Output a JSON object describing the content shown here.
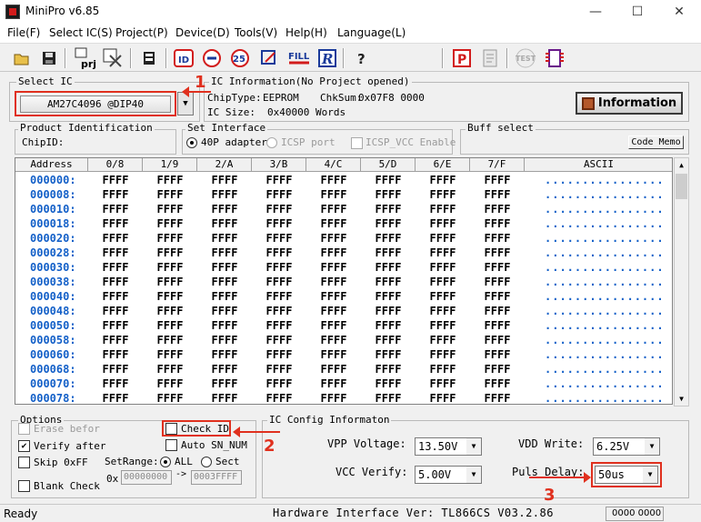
{
  "window": {
    "title": "MiniPro v6.85",
    "min": "—",
    "max": "☐",
    "close": "✕"
  },
  "menu": [
    "File(F)",
    "Select IC(S)",
    "Project(P)",
    "Device(D)",
    "Tools(V)",
    "Help(H)",
    "Language(L)"
  ],
  "toolbar": {
    "prj_label": "prj",
    "test_label": "TEST",
    "fill_label": "FILL",
    "r_label": "R",
    "id_label": "ID",
    "count_label": "25",
    "help_label": "?",
    "p_label": "P"
  },
  "select_ic": {
    "title": "Select IC",
    "value": "AM27C4096   @DIP40"
  },
  "ic_info": {
    "title": "IC Information(No Project opened)",
    "chip_type_label": "ChipType:",
    "chip_type": "EEPROM",
    "chksum_label": "ChkSum:",
    "chksum": "0x07F8 0000",
    "ic_size_label": "IC Size:",
    "ic_size": "0x40000 Words",
    "info_button": "Information"
  },
  "product_id": {
    "title": "Product Identification",
    "chip_id_label": "ChipID:"
  },
  "set_interface": {
    "title": "Set Interface",
    "adapter": "40P adapter",
    "icsp": "ICSP port",
    "icsp_vcc": "ICSP_VCC Enable"
  },
  "buff_select": {
    "title": "Buff select",
    "code_memo": "Code Memo"
  },
  "grid": {
    "headers": [
      "Address",
      "0/8",
      "1/9",
      "2/A",
      "3/B",
      "4/C",
      "5/D",
      "6/E",
      "7/F",
      "ASCII"
    ],
    "addresses": [
      "000000:",
      "000008:",
      "000010:",
      "000018:",
      "000020:",
      "000028:",
      "000030:",
      "000038:",
      "000040:",
      "000048:",
      "000050:",
      "000058:",
      "000060:",
      "000068:",
      "000070:",
      "000078:"
    ],
    "cell_value": "FFFF",
    "ascii": "................"
  },
  "options": {
    "title": "Options",
    "erase_before": "Erase befor",
    "verify_after": "Verify after",
    "skip_0xff": "Skip 0xFF",
    "blank_check": "Blank Check",
    "check_id": "Check ID",
    "auto_sn": "Auto SN_NUM",
    "set_range": "SetRange:",
    "all": "ALL",
    "sect": "Sect",
    "ox": "0x",
    "range_start": "00000000",
    "range_arrow": "->",
    "range_end": "0003FFFF"
  },
  "ic_config": {
    "title": "IC Config Informaton",
    "vpp_label": "VPP Voltage:",
    "vpp_value": "13.50V",
    "vcc_label": "VCC Verify:",
    "vcc_value": "5.00V",
    "vdd_label": "VDD Write:",
    "vdd_value": "6.25V",
    "puls_label": "Puls Delay:",
    "puls_value": "50us"
  },
  "annotations": {
    "n1": "1",
    "n2": "2",
    "n3": "3"
  },
  "status": {
    "ready": "Ready",
    "hardware": "Hardware Interface Ver: TL866CS V03.2.86",
    "counter": "0000 0000"
  },
  "colors": {
    "accent_red": "#e0301e",
    "address_blue": "#1460c8"
  }
}
